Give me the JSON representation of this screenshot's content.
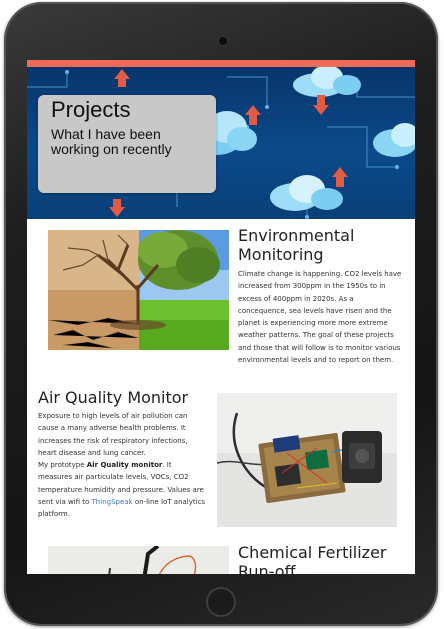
{
  "hero": {
    "title": "Projects",
    "subtitle": "What I have been working on recently"
  },
  "projects": [
    {
      "title": "Environmental Monitoring",
      "body": "Climate change is happening. CO2 levels have increased from 300ppm in the 1950s to in excess of 400ppm in 2020s. As a concequence, sea levels have risen and the planet is experiencing more more extreme weather patterns. The goal of these projects and those that will follow is to monitor various environmental levels and to report on them.",
      "image": "tree-half-dead-half-alive-image"
    },
    {
      "title": "Air Quality Monitor",
      "body_p1": "Exposure to high levels of air pollution can cause a many adverse health problems. It increases the risk of respiratory infections, heart disease and lung cancer.",
      "body_p2_prefix": "My prototype ",
      "body_p2_bold": "Air Quality monitor",
      "body_p2_mid": ". It measures air particulate levels, VOCs, CO2 temperature humidity and pressure. Values are sent via wifi to ",
      "body_p2_link": "ThingSpeak",
      "body_p2_suffix": " on-line IoT analytics platform.",
      "image": "circuit-board-prototype-image"
    },
    {
      "title": "Chemical Fertilizer Run-off",
      "image": "cable-sensor-image"
    }
  ],
  "colors": {
    "accent_bar": "#ef6b57",
    "hero_bg": "#0b4a8a",
    "link": "#3a7bd5"
  }
}
